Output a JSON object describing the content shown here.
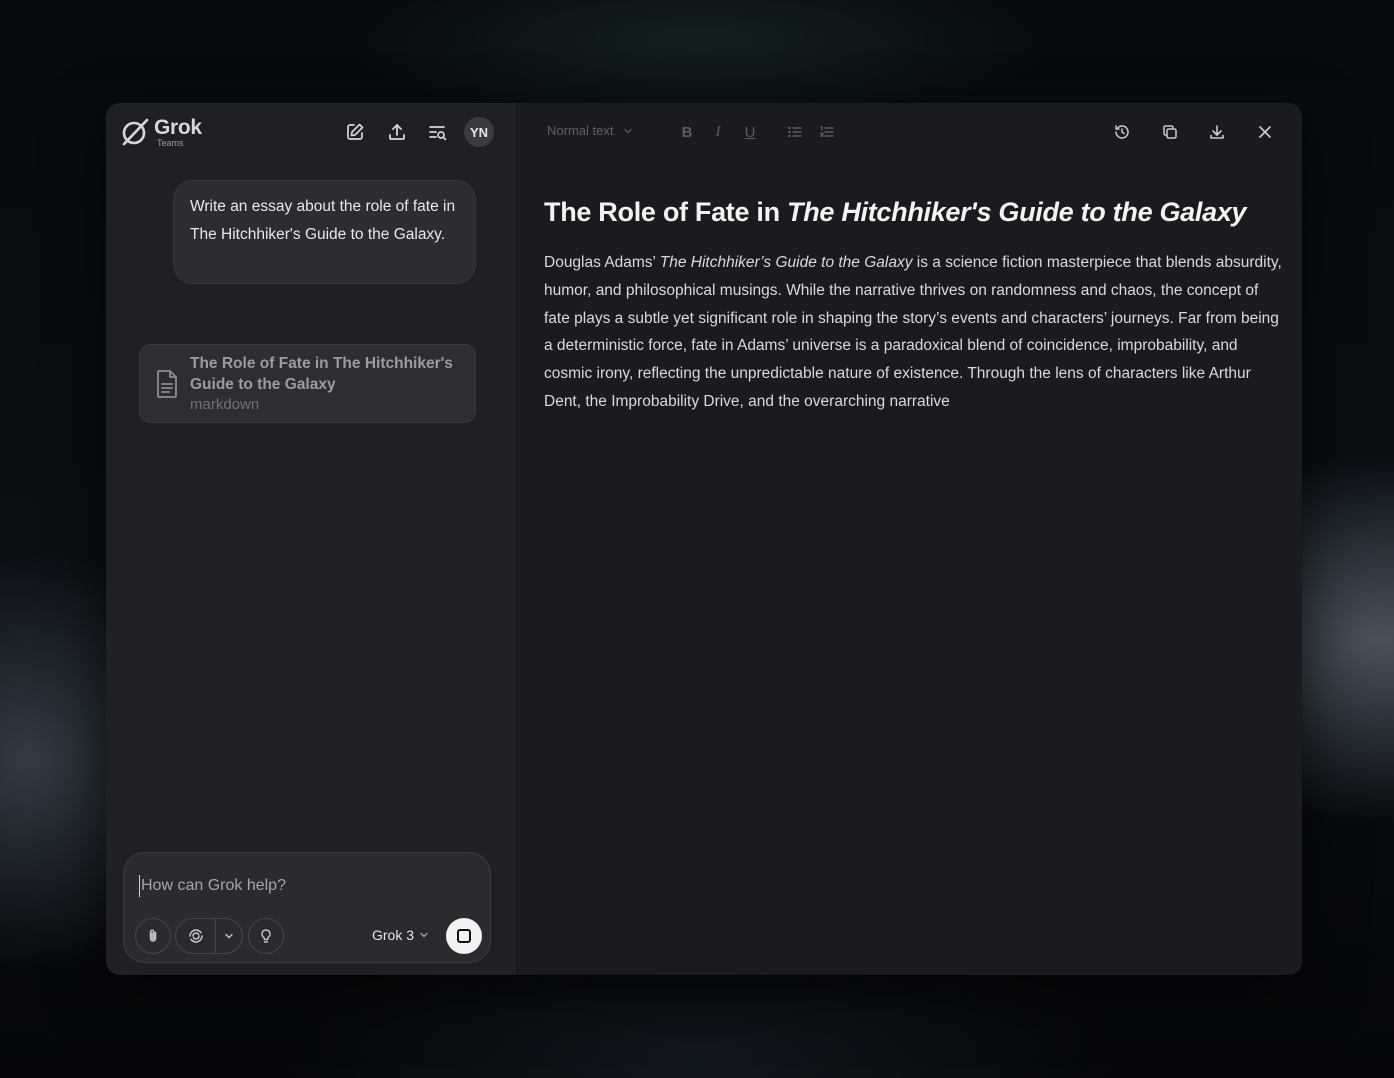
{
  "app": {
    "logo_name": "Grok",
    "logo_sub": "Teams",
    "avatar_initials": "YN"
  },
  "header_icons": [
    "new-chat-icon",
    "share-icon",
    "search-history-icon"
  ],
  "chat": {
    "user_message": "Write an essay about the role of fate in The Hitchhiker's Guide to the Galaxy.",
    "artifact": {
      "title": "The Role of Fate in The Hitchhiker's Guide to the Galaxy",
      "type": "markdown"
    }
  },
  "composer": {
    "placeholder": "How can Grok help?",
    "model": "Grok 3"
  },
  "toolbar": {
    "text_style": "Normal text",
    "format_buttons": [
      "B",
      "I",
      "U"
    ],
    "right_icons": [
      "history-icon",
      "copy-icon",
      "download-icon",
      "close-icon"
    ]
  },
  "document": {
    "title_prefix": "The Role of Fate in ",
    "title_italic": "The Hitchhiker's Guide to the Galaxy",
    "body_prefix": "Douglas Adams’ ",
    "body_italic": "The Hitchhiker’s Guide to the Galaxy",
    "body_rest": " is a science fiction masterpiece that blends absurdity, humor, and philosophical musings. While the narrative thrives on randomness and chaos, the concept of fate plays a subtle yet significant role in shaping the story’s events and characters’ journeys. Far from being a deterministic force, fate in Adams’ universe is a paradoxical blend of coincidence, improbability, and cosmic irony, reflecting the unpredictable nature of existence. Through the lens of characters like Arthur Dent, the Improbability Drive, and the overarching narrative"
  },
  "colors": {
    "window_bg": "#1d1e21",
    "doc_bg": "#1a1b1e",
    "bubble_bg": "#2c2d31",
    "send_button": "#f2f2f3"
  }
}
